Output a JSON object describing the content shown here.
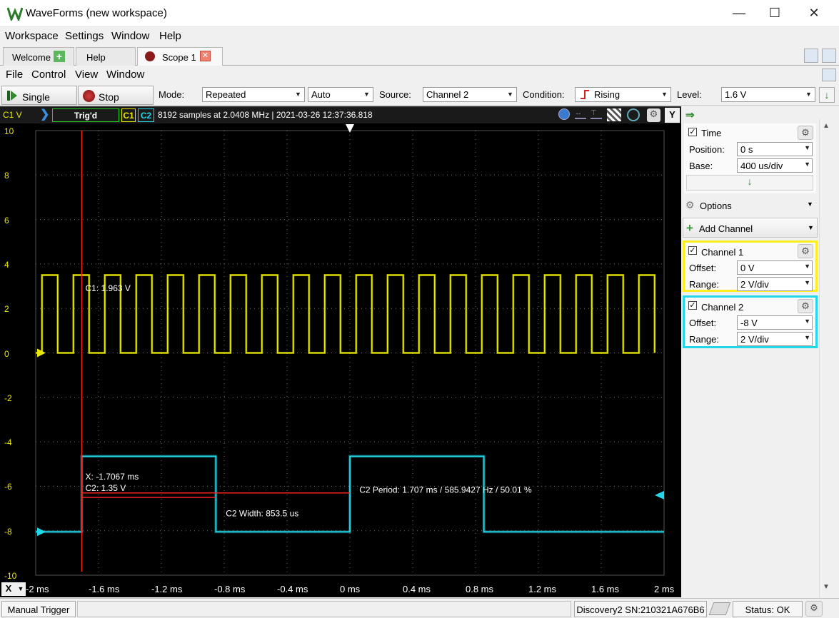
{
  "app": {
    "title": "WaveForms (new workspace)"
  },
  "menu_main": [
    "Workspace",
    "Settings",
    "Window",
    "Help"
  ],
  "tabs": [
    {
      "label": "Welcome"
    },
    {
      "label": "Help"
    },
    {
      "label": "Scope 1"
    }
  ],
  "menu_scope": [
    "File",
    "Control",
    "View",
    "Window"
  ],
  "toolbar": {
    "single": "Single",
    "stop": "Stop",
    "mode_label": "Mode:",
    "mode_value": "Repeated",
    "auto_value": "Auto",
    "source_label": "Source:",
    "source_value": "Channel 2",
    "condition_label": "Condition:",
    "condition_value": "Rising",
    "level_label": "Level:",
    "level_value": "1.6 V"
  },
  "scope_header": {
    "unit": "C1 V",
    "trig_status": "Trig'd",
    "c1": "C1",
    "c2": "C2",
    "info": "8192 samples at 2.0408 MHz | 2021-03-26 12:37:36.818",
    "y_button": "Y"
  },
  "y_ticks": [
    "10",
    "8",
    "6",
    "4",
    "2",
    "0",
    "-2",
    "-4",
    "-6",
    "-8",
    "-10"
  ],
  "x_axis": {
    "label": "X",
    "ticks": [
      "-2 ms",
      "-1.6 ms",
      "-1.2 ms",
      "-0.8 ms",
      "-0.4 ms",
      "0 ms",
      "0.4 ms",
      "0.8 ms",
      "1.2 ms",
      "1.6 ms",
      "2 ms"
    ]
  },
  "annotations": {
    "c1_cursor": "C1: 1.963 V",
    "cursor_x": "X: -1.7067 ms",
    "cursor_c2": "C2: 1.35 V",
    "c2_width": "C2 Width: 853.5 us",
    "c2_period": "C2 Period: 1.707 ms / 585.9427 Hz / 50.01 %"
  },
  "panel": {
    "time": {
      "title": "Time",
      "position_label": "Position:",
      "position_value": "0 s",
      "base_label": "Base:",
      "base_value": "400 us/div"
    },
    "options": "Options",
    "add_channel": "Add Channel",
    "channel1": {
      "title": "Channel 1",
      "offset_label": "Offset:",
      "offset_value": "0 V",
      "range_label": "Range:",
      "range_value": "2 V/div"
    },
    "channel2": {
      "title": "Channel 2",
      "offset_label": "Offset:",
      "offset_value": "-8 V",
      "range_label": "Range:",
      "range_value": "2 V/div"
    }
  },
  "status": {
    "manual_trigger": "Manual Trigger",
    "device": "Discovery2 SN:210321A676B6",
    "status": "Status: OK"
  },
  "colors": {
    "c1": "#e8e800",
    "c2": "#22d8e8",
    "cursor": "#ff2020",
    "grid": "#707070"
  },
  "signals": {
    "x_range_ms": [
      -2,
      2
    ],
    "y_range_v": [
      -10,
      10
    ],
    "c1": {
      "low_v": 0,
      "high_v": 3.5,
      "period_ms": 0.2,
      "first_rise_ms": -1.96
    },
    "c2": {
      "low_v": -8.05,
      "high_v": -4.65,
      "period_ms": 1.707,
      "duty_percent": 50.01,
      "rise_ms": [
        -1.7067,
        0
      ],
      "fall_ms": [
        -0.853,
        0.853
      ]
    },
    "cursor_x_ms": -1.7067
  }
}
